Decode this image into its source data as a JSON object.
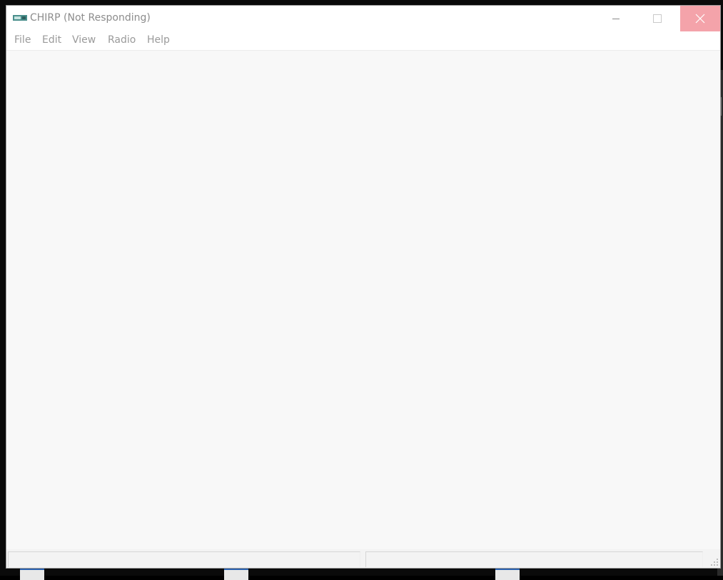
{
  "window": {
    "title": "CHIRP (Not Responding)",
    "app_icon": "radio-icon",
    "controls": {
      "minimize": "minimize-icon",
      "maximize": "maximize-icon",
      "close": "close-icon"
    }
  },
  "menubar": {
    "items": [
      {
        "label": "File"
      },
      {
        "label": "Edit"
      },
      {
        "label": "View"
      },
      {
        "label": "Radio"
      },
      {
        "label": "Help"
      }
    ]
  },
  "statusbar": {
    "panels": [
      "",
      ""
    ]
  },
  "colors": {
    "title_text": "#8c8c8c",
    "menu_text": "#9a9a9a",
    "close_hover": "#f4a3aa",
    "content_bg": "#f8f8f8"
  }
}
